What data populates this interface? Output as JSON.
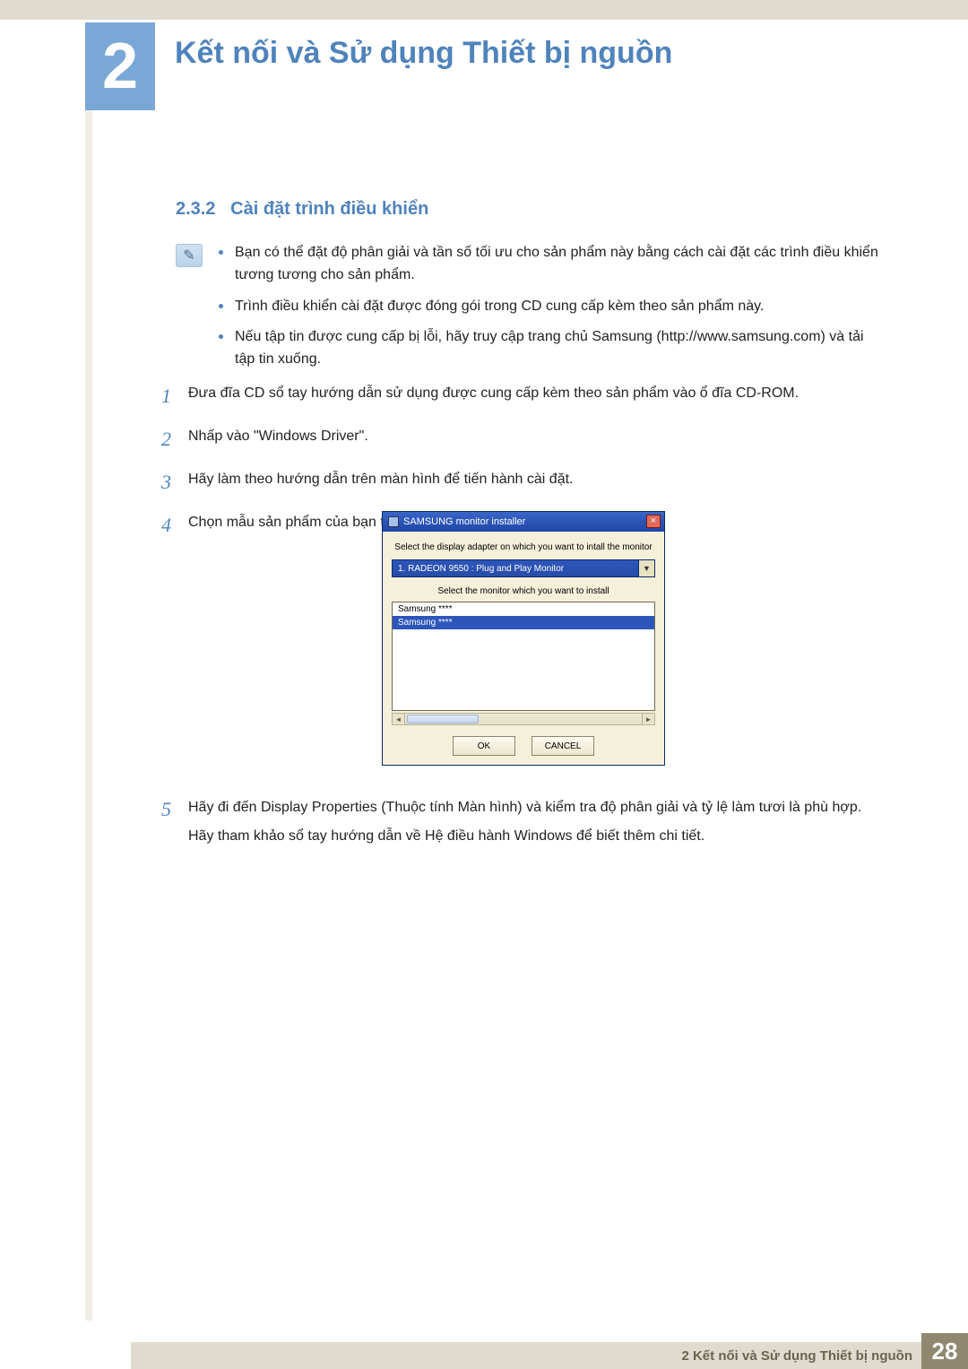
{
  "chapter": {
    "number": "2",
    "title": "Kết nối và Sử dụng Thiết bị nguồn"
  },
  "section": {
    "number": "2.3.2",
    "title": "Cài đặt trình điều khiển"
  },
  "info": {
    "items": [
      "Bạn có thể đặt độ phân giải và tần số tối ưu cho sản phẩm này bằng cách cài đặt các trình điều khiển tương tương cho sản phẩm.",
      "Trình điều khiển cài đặt được đóng gói trong CD cung cấp kèm theo sản phẩm này.",
      "Nếu tập tin được cung cấp bị lỗi, hãy truy cập trang chủ Samsung (http://www.samsung.com) và tải tập tin xuống."
    ]
  },
  "steps": {
    "s1": {
      "n": "1",
      "t": "Đưa đĩa CD sổ tay hướng dẫn sử dụng được cung cấp kèm theo sản phẩm vào ổ đĩa CD-ROM."
    },
    "s2": {
      "n": "2",
      "t": "Nhấp vào \"Windows Driver\"."
    },
    "s3": {
      "n": "3",
      "t": "Hãy làm theo hướng dẫn trên màn hình để tiến hành cài đặt."
    },
    "s4": {
      "n": "4",
      "t": "Chọn mẫu sản phẩm của bạn từ danh sách mẫu."
    },
    "s5": {
      "n": "5",
      "t1": "Hãy đi đến Display Properties (Thuộc tính Màn hình) và kiểm tra độ phân giải và tỷ lệ làm tươi là phù hợp.",
      "t2": "Hãy tham khảo sổ tay hướng dẫn về Hệ điều hành Windows để biết thêm chi tiết."
    }
  },
  "dialog": {
    "title": "SAMSUNG monitor installer",
    "label1": "Select the display adapter on which you want to intall the monitor",
    "select_value": "1. RADEON 9550 : Plug and Play Monitor",
    "label2": "Select the monitor which you want to install",
    "list": {
      "r0": "Samsung ****",
      "r1": "Samsung ****"
    },
    "ok": "OK",
    "cancel": "CANCEL"
  },
  "footer": {
    "text": "2 Kết nối và Sử dụng Thiết bị nguồn",
    "page": "28"
  }
}
